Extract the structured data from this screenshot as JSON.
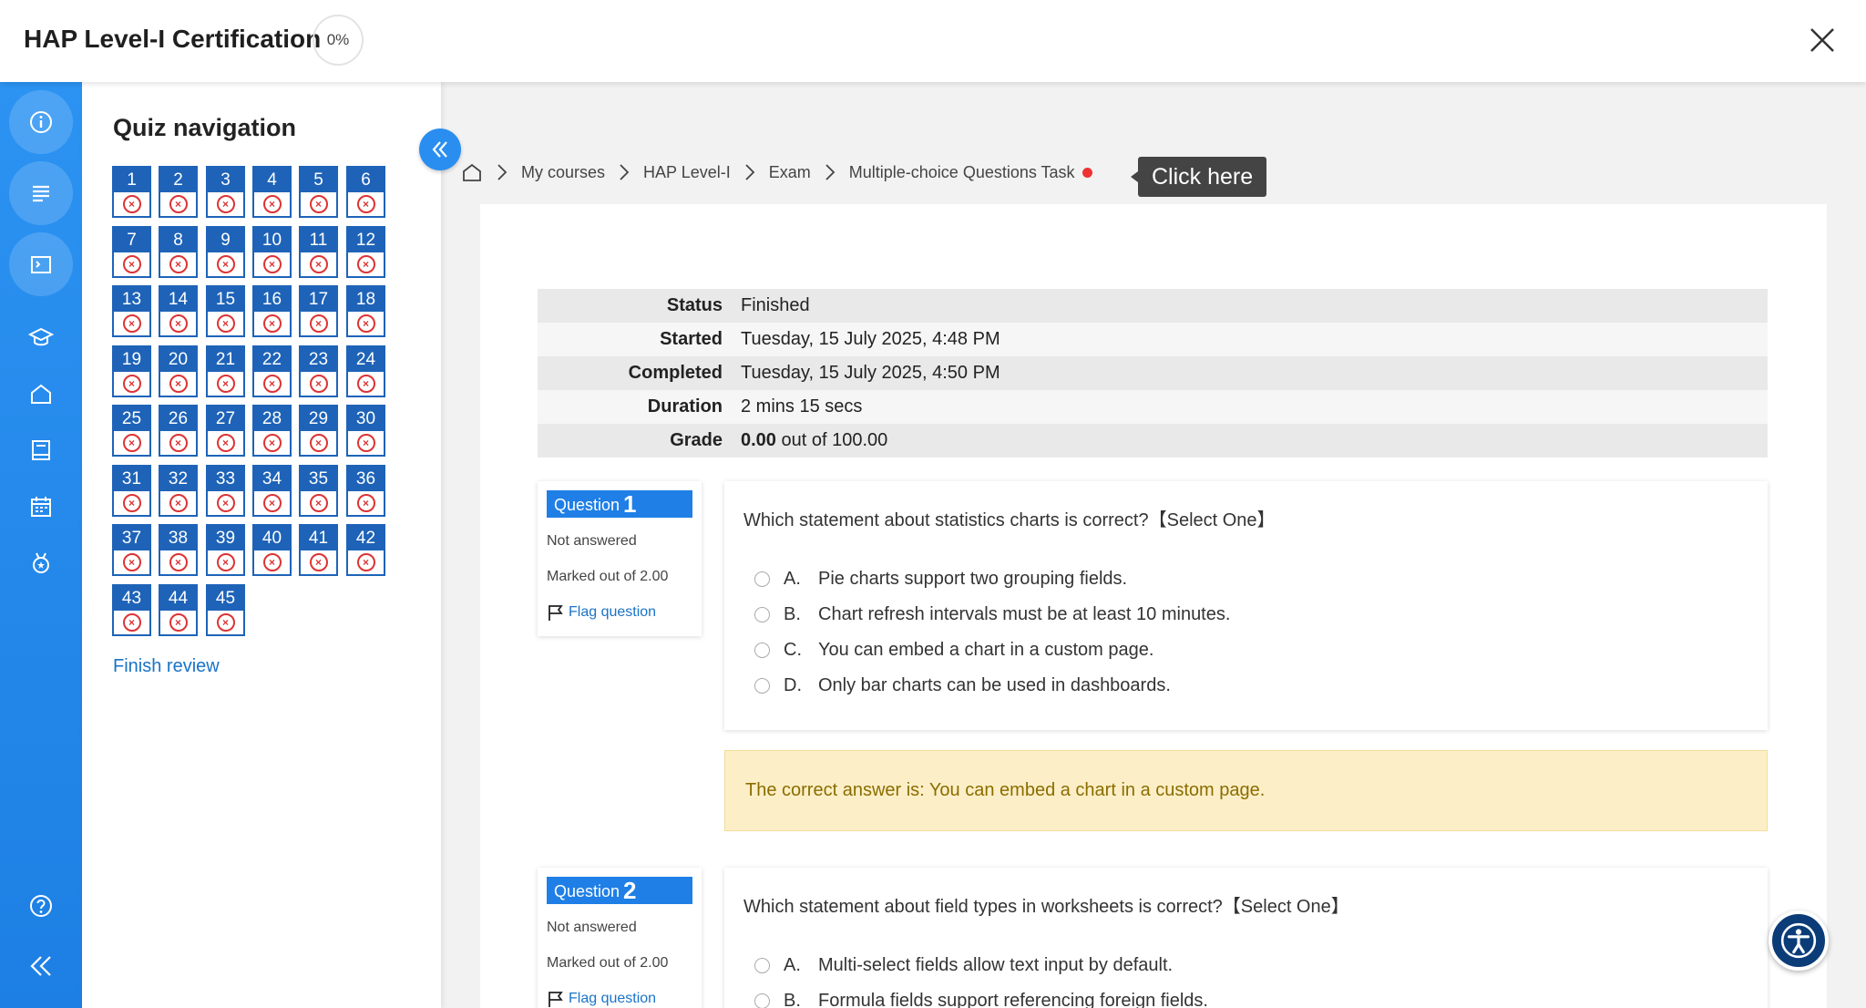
{
  "header": {
    "title": "HAP Level-I Certification",
    "progress": "0%"
  },
  "rail": {
    "icons": [
      "info-icon",
      "list-icon",
      "quiz-icon",
      "graduation-cap-icon",
      "home-icon",
      "book-icon",
      "calendar-icon",
      "medal-icon",
      "help-icon",
      "collapse-icon"
    ]
  },
  "quiz_nav": {
    "title": "Quiz navigation",
    "questions": [
      "1",
      "2",
      "3",
      "4",
      "5",
      "6",
      "7",
      "8",
      "9",
      "10",
      "11",
      "12",
      "13",
      "14",
      "15",
      "16",
      "17",
      "18",
      "19",
      "20",
      "21",
      "22",
      "23",
      "24",
      "25",
      "26",
      "27",
      "28",
      "29",
      "30",
      "31",
      "32",
      "33",
      "34",
      "35",
      "36",
      "37",
      "38",
      "39",
      "40",
      "41",
      "42",
      "43",
      "44",
      "45"
    ],
    "status": "incorrect",
    "finish_label": "Finish review"
  },
  "breadcrumb": {
    "items": [
      "My courses",
      "HAP Level-I",
      "Exam",
      "Multiple-choice Questions Task"
    ],
    "tooltip": "Click here"
  },
  "summary": {
    "rows": [
      {
        "label": "Status",
        "value": "Finished"
      },
      {
        "label": "Started",
        "value": "Tuesday, 15 July 2025, 4:48 PM"
      },
      {
        "label": "Completed",
        "value": "Tuesday, 15 July 2025, 4:50 PM"
      },
      {
        "label": "Duration",
        "value": "2 mins 15 secs"
      }
    ],
    "grade_label": "Grade",
    "grade_value": "0.00",
    "grade_suffix": "out of 100.00"
  },
  "questions": [
    {
      "label": "Question",
      "number": "1",
      "state": "Not answered",
      "marks": "Marked out of 2.00",
      "flag": "Flag question",
      "text": "Which statement about statistics charts is correct?【Select One】",
      "options": [
        {
          "letter": "A.",
          "text": "Pie charts support two grouping fields."
        },
        {
          "letter": "B.",
          "text": "Chart refresh intervals must be at least 10 minutes."
        },
        {
          "letter": "C.",
          "text": "You can embed a chart in a custom page."
        },
        {
          "letter": "D.",
          "text": "Only bar charts can be used in dashboards."
        }
      ],
      "correct_answer": "The correct answer is: You can embed a chart in a custom page."
    },
    {
      "label": "Question",
      "number": "2",
      "state": "Not answered",
      "marks": "Marked out of 2.00",
      "flag": "Flag question",
      "text": "Which statement about field types in worksheets is correct?【Select One】",
      "options": [
        {
          "letter": "A.",
          "text": "Multi-select fields allow text input by default."
        },
        {
          "letter": "B.",
          "text": "Formula fields support referencing foreign fields."
        }
      ]
    }
  ],
  "colors": {
    "primary": "#1f7fe6",
    "nav_button": "#1e63b8",
    "incorrect": "#dd3333",
    "answer_bg": "#fcefc7",
    "answer_text": "#8a6d00"
  }
}
